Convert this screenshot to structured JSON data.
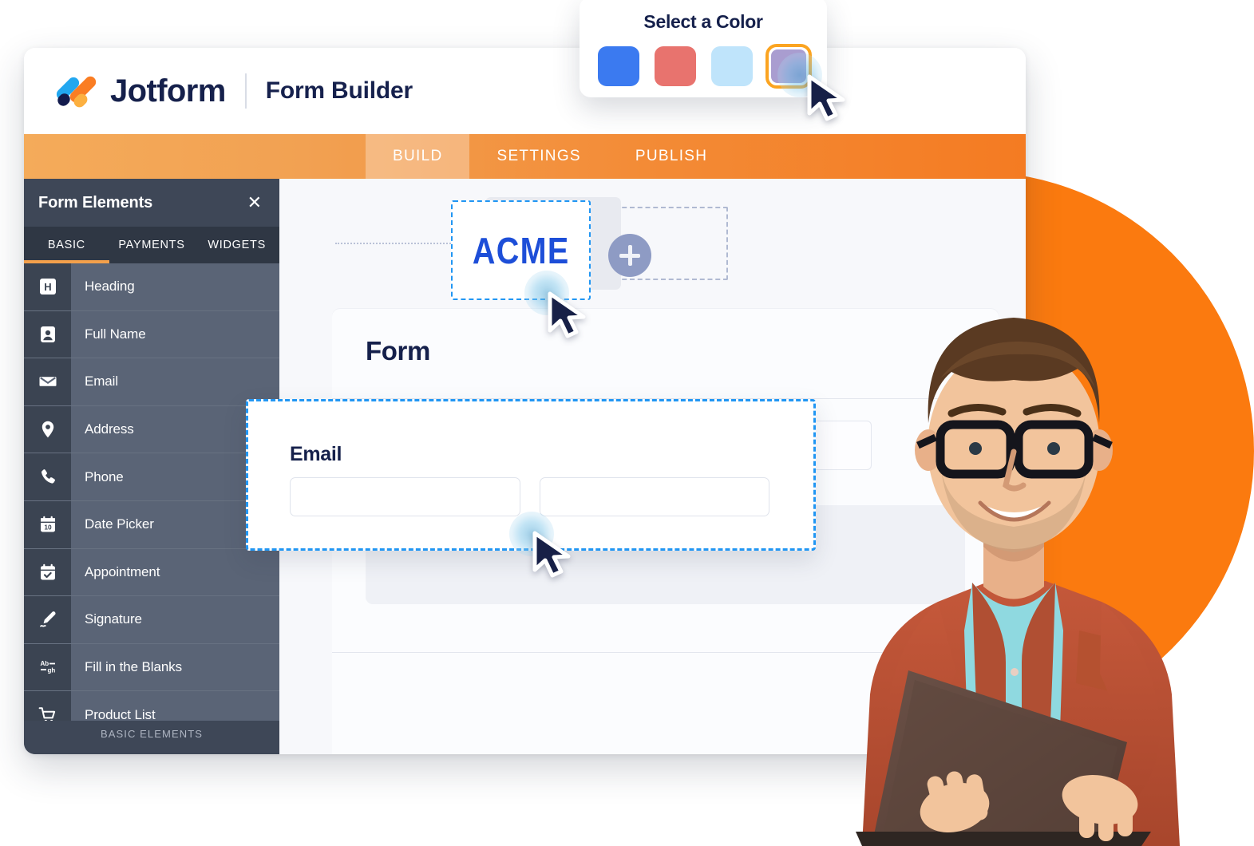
{
  "header": {
    "brand": "Jotform",
    "product": "Form Builder",
    "logo_icon": "jotform-logo-icon"
  },
  "nav": {
    "tabs": [
      {
        "label": "BUILD",
        "active": true
      },
      {
        "label": "SETTINGS",
        "active": false
      },
      {
        "label": "PUBLISH",
        "active": false
      }
    ]
  },
  "sidebar": {
    "title": "Form Elements",
    "close_icon": "close-icon",
    "tabs": [
      {
        "label": "BASIC",
        "active": true
      },
      {
        "label": "PAYMENTS",
        "active": false
      },
      {
        "label": "WIDGETS",
        "active": false
      }
    ],
    "items": [
      {
        "label": "Heading",
        "icon": "heading-icon"
      },
      {
        "label": "Full Name",
        "icon": "user-card-icon"
      },
      {
        "label": "Email",
        "icon": "envelope-icon"
      },
      {
        "label": "Address",
        "icon": "map-pin-icon"
      },
      {
        "label": "Phone",
        "icon": "phone-icon"
      },
      {
        "label": "Date Picker",
        "icon": "calendar-10-icon"
      },
      {
        "label": "Appointment",
        "icon": "calendar-check-icon"
      },
      {
        "label": "Signature",
        "icon": "signature-pen-icon"
      },
      {
        "label": "Fill in the Blanks",
        "icon": "fill-blanks-icon"
      },
      {
        "label": "Product List",
        "icon": "shopping-cart-icon"
      }
    ],
    "footer_label": "BASIC ELEMENTS"
  },
  "canvas": {
    "logo_text": "ACME",
    "add_button_icon": "plus-icon",
    "form_title": "Form"
  },
  "email_element": {
    "label": "Email",
    "input_left_value": "",
    "input_left_placeholder": "",
    "input_right_value": "",
    "input_right_placeholder": ""
  },
  "color_picker": {
    "title": "Select a Color",
    "swatches": [
      {
        "name": "blue",
        "hex": "#3b7af0",
        "selected": false
      },
      {
        "name": "salmon",
        "hex": "#e8736e",
        "selected": false
      },
      {
        "name": "light-blue",
        "hex": "#bfe4fb",
        "selected": false
      },
      {
        "name": "purple",
        "hex": "#a99dd0",
        "selected": true
      }
    ],
    "selected_ring_hex": "#fba421"
  },
  "theme": {
    "accent_orange": "#fb7a0f",
    "navbar_orange": "#f38b36",
    "sidebar_dark": "#3e4757",
    "sidebar_row": "#5a6476",
    "sidebar_icon_tile": "#3b4452",
    "navy_text": "#15204b",
    "selection_blue": "#2196f3"
  }
}
